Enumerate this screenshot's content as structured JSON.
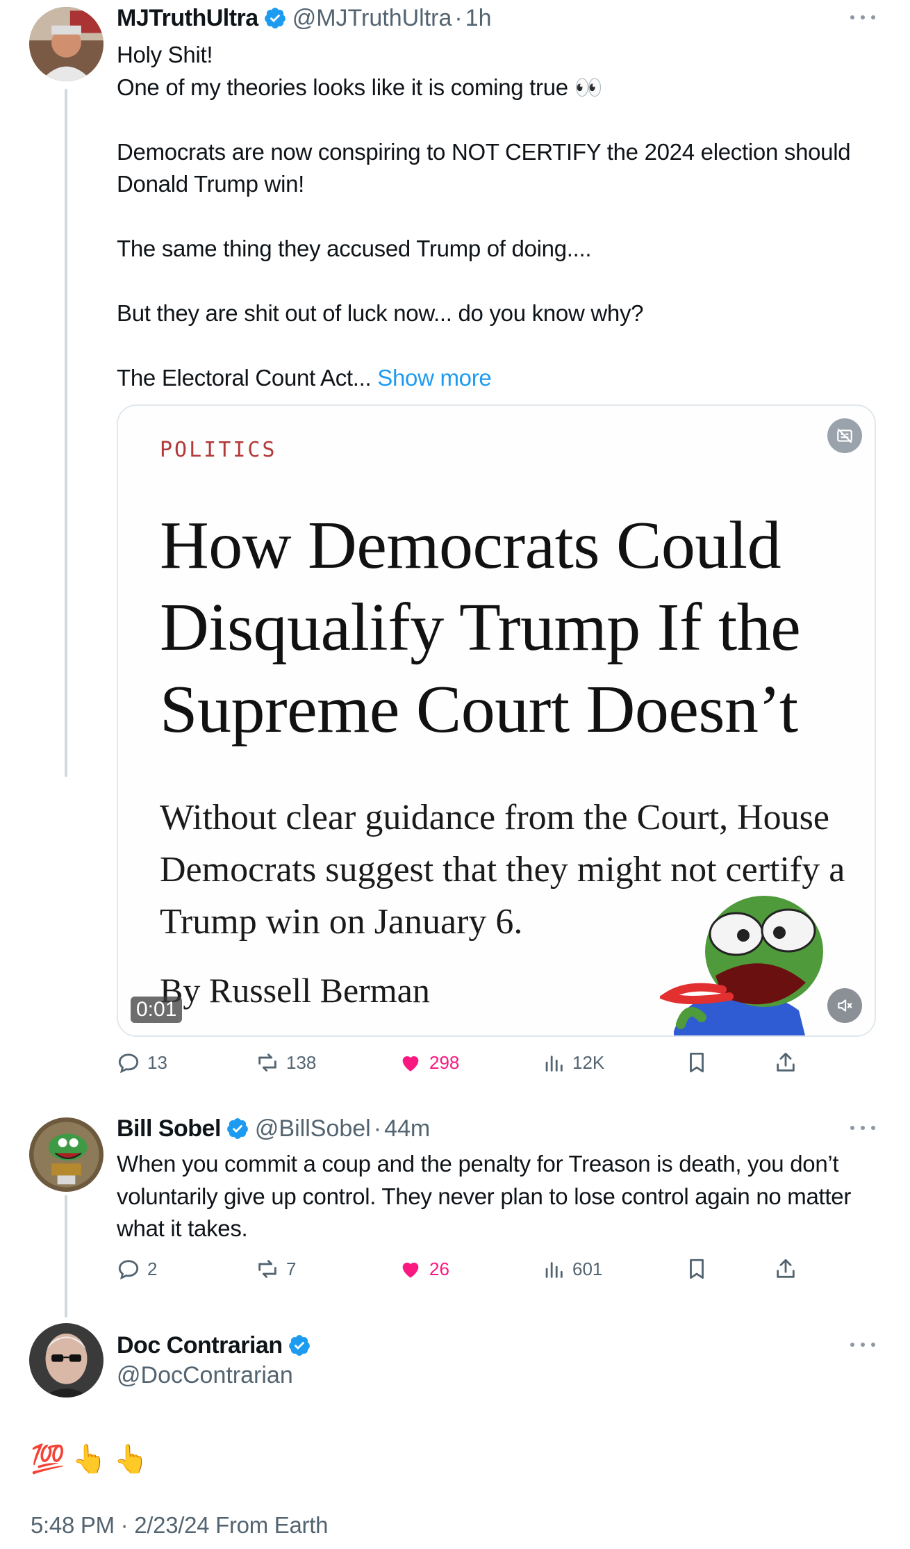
{
  "tweets": [
    {
      "name": "MJTruthUltra",
      "handle": "@MJTruthUltra",
      "sep": "·",
      "time": "1h",
      "paragraphs": [
        "Holy Shit!",
        "One of my theories looks like it is coming true 👀",
        "Democrats are now conspiring to NOT CERTIFY the 2024 election should Donald Trump win!",
        "The same thing they accused Trump of doing....",
        "But they are shit out of luck now... do you know why?",
        "The Electoral Count Act..."
      ],
      "show_more": "Show more",
      "media": {
        "category": "POLITICS",
        "title": "How Democrats Could Disqualify Trump If the Supreme Court Doesn’t",
        "subtitle": "Without clear guidance from the Court, House Democrats suggest that they might not certify a Trump win on January 6.",
        "byline": "By Russell Berman",
        "duration": "0:01"
      },
      "actions": {
        "replies": "13",
        "reposts": "138",
        "likes": "298",
        "views": "12K"
      }
    },
    {
      "name": "Bill Sobel",
      "handle": "@BillSobel",
      "sep": "·",
      "time": "44m",
      "text": "When you commit a coup and the penalty for Treason is death, you don’t voluntarily give up control. They never plan to lose control again no matter what it takes.",
      "actions": {
        "replies": "2",
        "reposts": "7",
        "likes": "26",
        "views": "601"
      }
    },
    {
      "name": "Doc Contrarian",
      "handle": "@DocContrarian",
      "emojis": [
        "💯",
        "👆",
        "👆"
      ],
      "timestamp": "5:48 PM · 2/23/24 From Earth"
    }
  ],
  "colors": {
    "accent": "#1d9bf0",
    "like": "#f91880",
    "muted": "#536471"
  }
}
